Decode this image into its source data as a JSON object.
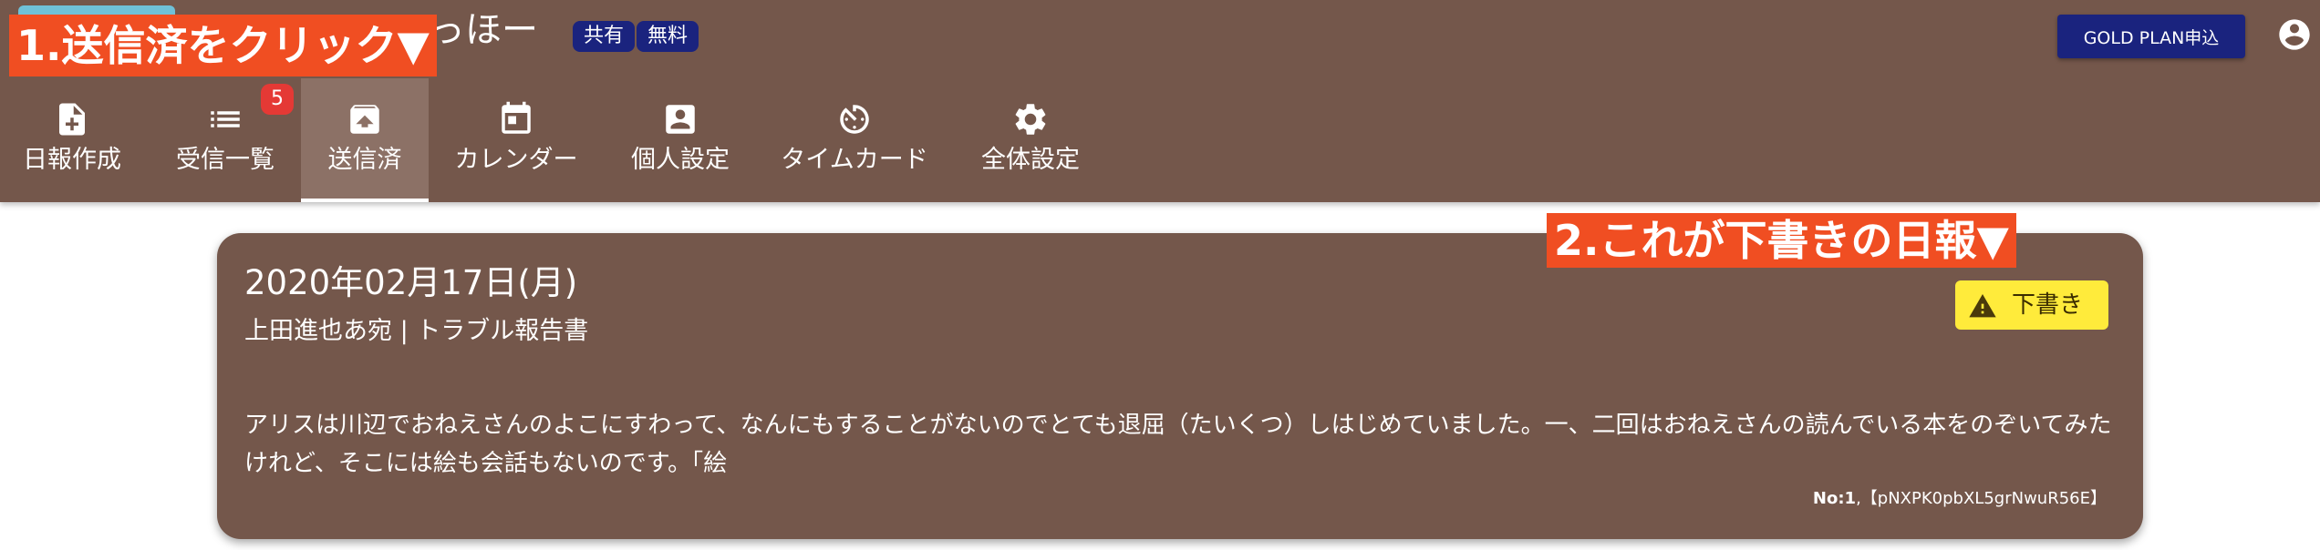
{
  "app": {
    "title": "っほー",
    "badges": [
      "共有",
      "無料"
    ],
    "gold_plan_label": "GOLD PLAN申込"
  },
  "tabs": [
    {
      "label": "日報作成",
      "icon": "note-add-icon"
    },
    {
      "label": "受信一覧",
      "icon": "list-icon",
      "count": "5"
    },
    {
      "label": "送信済",
      "icon": "archive-icon",
      "active": true
    },
    {
      "label": "カレンダー",
      "icon": "calendar-icon"
    },
    {
      "label": "個人設定",
      "icon": "account-box-icon"
    },
    {
      "label": "タイムカード",
      "icon": "timer-icon"
    },
    {
      "label": "全体設定",
      "icon": "gear-icon"
    }
  ],
  "report": {
    "date": "2020年02月17日(月)",
    "author_title": "上田進也あ宛 | トラブル報告書",
    "body": "アリスは川辺でおねえさんのよこにすわって、なんにもすることがないのでとても退屈（たいくつ）しはじめていました。一、二回はおねえさんの読んでいる本をのぞいてみたけれど、そこには絵も会話もないのです。「絵",
    "status": "下書き",
    "number_label": "No:1",
    "id_text": "【pNXPK0pbXL5grNwuR56E】"
  },
  "callouts": {
    "step1": "1.送信済をクリック▼",
    "step2": "2.これが下書きの日報▼"
  },
  "colors": {
    "appbar": "#74574b",
    "active_tab": "#8c7166",
    "badge": "#1a237e",
    "notification": "#e53935",
    "draft_chip": "#ffeb3b",
    "callout": "#f04e22"
  }
}
